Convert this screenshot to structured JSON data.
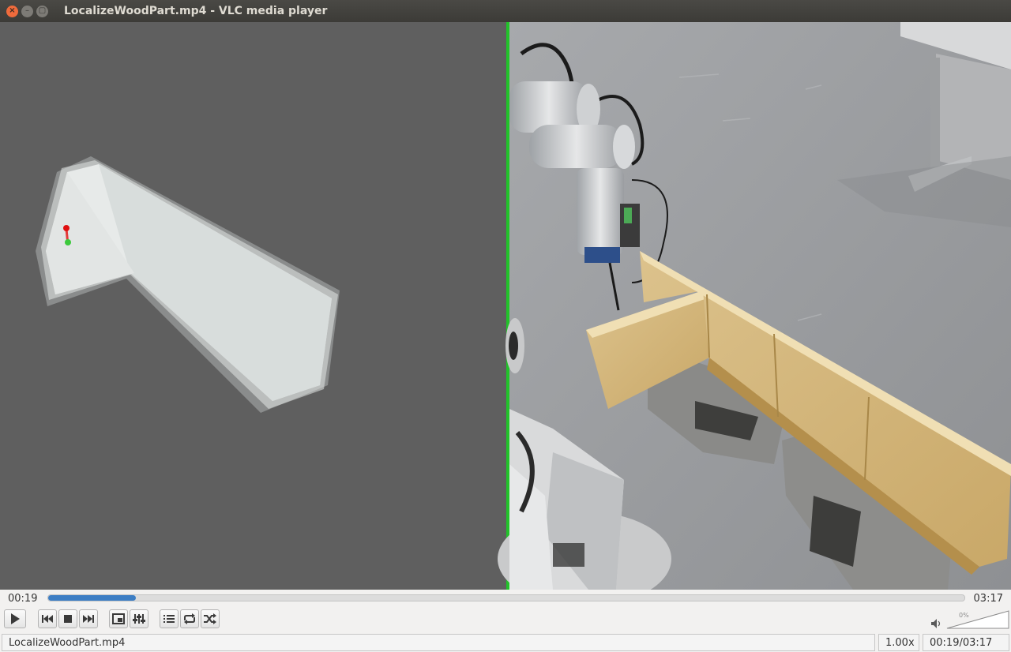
{
  "window": {
    "title": "LocalizeWoodPart.mp4 - VLC media player",
    "close_glyph": "×",
    "minimize_glyph": "–",
    "maximize_glyph": "▢"
  },
  "playback": {
    "elapsed": "00:19",
    "total": "03:17",
    "progress_fraction": 0.096
  },
  "controls": {
    "buttons": [
      "play-icon",
      "previous-icon",
      "stop-icon",
      "next-icon",
      "fullscreen-icon",
      "extended-settings-icon",
      "playlist-icon",
      "loop-icon",
      "shuffle-icon"
    ],
    "volume_percent": "0%",
    "volume_icon": "speaker-icon"
  },
  "statusbar": {
    "filename": "LocalizeWoodPart.mp4",
    "speed": "1.00x",
    "time": "00:19/03:17"
  },
  "colors": {
    "accent": "#3d7ec4",
    "divider": "#22c22a"
  }
}
